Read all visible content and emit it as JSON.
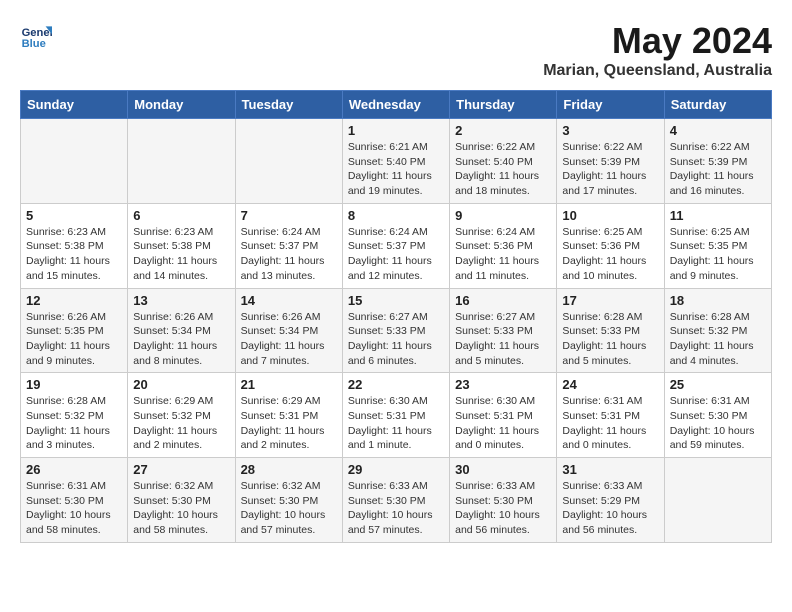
{
  "logo": {
    "line1": "General",
    "line2": "Blue"
  },
  "title": "May 2024",
  "location": "Marian, Queensland, Australia",
  "days_header": [
    "Sunday",
    "Monday",
    "Tuesday",
    "Wednesday",
    "Thursday",
    "Friday",
    "Saturday"
  ],
  "weeks": [
    [
      {
        "num": "",
        "info": ""
      },
      {
        "num": "",
        "info": ""
      },
      {
        "num": "",
        "info": ""
      },
      {
        "num": "1",
        "info": "Sunrise: 6:21 AM\nSunset: 5:40 PM\nDaylight: 11 hours\nand 19 minutes."
      },
      {
        "num": "2",
        "info": "Sunrise: 6:22 AM\nSunset: 5:40 PM\nDaylight: 11 hours\nand 18 minutes."
      },
      {
        "num": "3",
        "info": "Sunrise: 6:22 AM\nSunset: 5:39 PM\nDaylight: 11 hours\nand 17 minutes."
      },
      {
        "num": "4",
        "info": "Sunrise: 6:22 AM\nSunset: 5:39 PM\nDaylight: 11 hours\nand 16 minutes."
      }
    ],
    [
      {
        "num": "5",
        "info": "Sunrise: 6:23 AM\nSunset: 5:38 PM\nDaylight: 11 hours\nand 15 minutes."
      },
      {
        "num": "6",
        "info": "Sunrise: 6:23 AM\nSunset: 5:38 PM\nDaylight: 11 hours\nand 14 minutes."
      },
      {
        "num": "7",
        "info": "Sunrise: 6:24 AM\nSunset: 5:37 PM\nDaylight: 11 hours\nand 13 minutes."
      },
      {
        "num": "8",
        "info": "Sunrise: 6:24 AM\nSunset: 5:37 PM\nDaylight: 11 hours\nand 12 minutes."
      },
      {
        "num": "9",
        "info": "Sunrise: 6:24 AM\nSunset: 5:36 PM\nDaylight: 11 hours\nand 11 minutes."
      },
      {
        "num": "10",
        "info": "Sunrise: 6:25 AM\nSunset: 5:36 PM\nDaylight: 11 hours\nand 10 minutes."
      },
      {
        "num": "11",
        "info": "Sunrise: 6:25 AM\nSunset: 5:35 PM\nDaylight: 11 hours\nand 9 minutes."
      }
    ],
    [
      {
        "num": "12",
        "info": "Sunrise: 6:26 AM\nSunset: 5:35 PM\nDaylight: 11 hours\nand 9 minutes."
      },
      {
        "num": "13",
        "info": "Sunrise: 6:26 AM\nSunset: 5:34 PM\nDaylight: 11 hours\nand 8 minutes."
      },
      {
        "num": "14",
        "info": "Sunrise: 6:26 AM\nSunset: 5:34 PM\nDaylight: 11 hours\nand 7 minutes."
      },
      {
        "num": "15",
        "info": "Sunrise: 6:27 AM\nSunset: 5:33 PM\nDaylight: 11 hours\nand 6 minutes."
      },
      {
        "num": "16",
        "info": "Sunrise: 6:27 AM\nSunset: 5:33 PM\nDaylight: 11 hours\nand 5 minutes."
      },
      {
        "num": "17",
        "info": "Sunrise: 6:28 AM\nSunset: 5:33 PM\nDaylight: 11 hours\nand 5 minutes."
      },
      {
        "num": "18",
        "info": "Sunrise: 6:28 AM\nSunset: 5:32 PM\nDaylight: 11 hours\nand 4 minutes."
      }
    ],
    [
      {
        "num": "19",
        "info": "Sunrise: 6:28 AM\nSunset: 5:32 PM\nDaylight: 11 hours\nand 3 minutes."
      },
      {
        "num": "20",
        "info": "Sunrise: 6:29 AM\nSunset: 5:32 PM\nDaylight: 11 hours\nand 2 minutes."
      },
      {
        "num": "21",
        "info": "Sunrise: 6:29 AM\nSunset: 5:31 PM\nDaylight: 11 hours\nand 2 minutes."
      },
      {
        "num": "22",
        "info": "Sunrise: 6:30 AM\nSunset: 5:31 PM\nDaylight: 11 hours\nand 1 minute."
      },
      {
        "num": "23",
        "info": "Sunrise: 6:30 AM\nSunset: 5:31 PM\nDaylight: 11 hours\nand 0 minutes."
      },
      {
        "num": "24",
        "info": "Sunrise: 6:31 AM\nSunset: 5:31 PM\nDaylight: 11 hours\nand 0 minutes."
      },
      {
        "num": "25",
        "info": "Sunrise: 6:31 AM\nSunset: 5:30 PM\nDaylight: 10 hours\nand 59 minutes."
      }
    ],
    [
      {
        "num": "26",
        "info": "Sunrise: 6:31 AM\nSunset: 5:30 PM\nDaylight: 10 hours\nand 58 minutes."
      },
      {
        "num": "27",
        "info": "Sunrise: 6:32 AM\nSunset: 5:30 PM\nDaylight: 10 hours\nand 58 minutes."
      },
      {
        "num": "28",
        "info": "Sunrise: 6:32 AM\nSunset: 5:30 PM\nDaylight: 10 hours\nand 57 minutes."
      },
      {
        "num": "29",
        "info": "Sunrise: 6:33 AM\nSunset: 5:30 PM\nDaylight: 10 hours\nand 57 minutes."
      },
      {
        "num": "30",
        "info": "Sunrise: 6:33 AM\nSunset: 5:30 PM\nDaylight: 10 hours\nand 56 minutes."
      },
      {
        "num": "31",
        "info": "Sunrise: 6:33 AM\nSunset: 5:29 PM\nDaylight: 10 hours\nand 56 minutes."
      },
      {
        "num": "",
        "info": ""
      }
    ]
  ]
}
